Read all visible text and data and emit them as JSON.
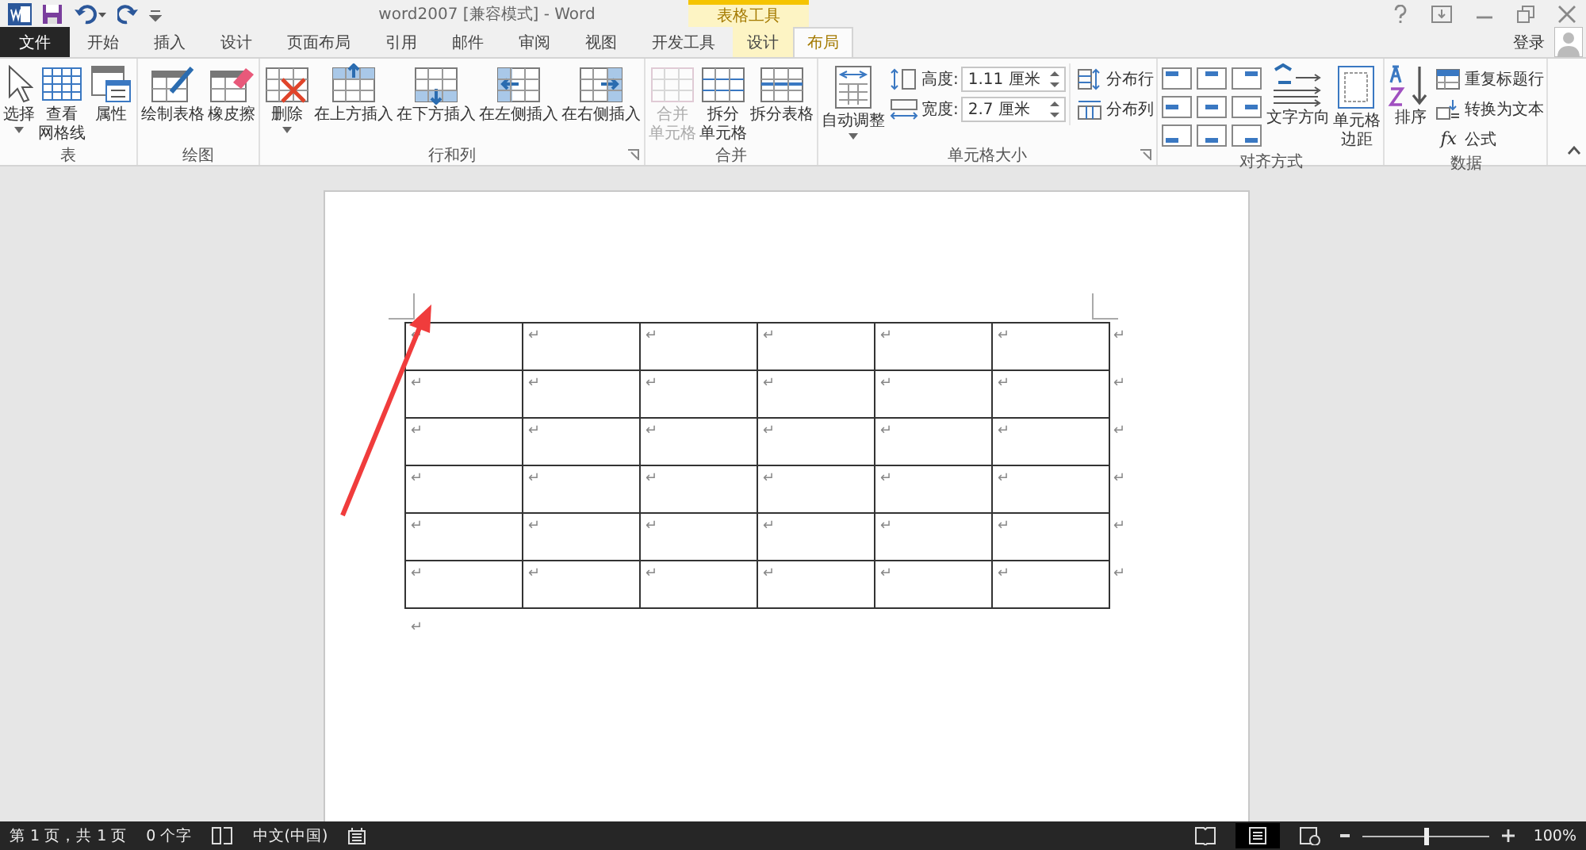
{
  "title_bar": {
    "title": "word2007 [兼容模式] - Word",
    "context_group": "表格工具",
    "login": "登录"
  },
  "tabs": [
    {
      "label": "文件",
      "kind": "file",
      "selected": false
    },
    {
      "label": "开始",
      "kind": "normal",
      "selected": false
    },
    {
      "label": "插入",
      "kind": "normal",
      "selected": false
    },
    {
      "label": "设计",
      "kind": "normal",
      "selected": false
    },
    {
      "label": "页面布局",
      "kind": "normal",
      "selected": false
    },
    {
      "label": "引用",
      "kind": "normal",
      "selected": false
    },
    {
      "label": "邮件",
      "kind": "normal",
      "selected": false
    },
    {
      "label": "审阅",
      "kind": "normal",
      "selected": false
    },
    {
      "label": "视图",
      "kind": "normal",
      "selected": false
    },
    {
      "label": "开发工具",
      "kind": "normal",
      "selected": false
    },
    {
      "label": "设计",
      "kind": "context",
      "selected": false
    },
    {
      "label": "布局",
      "kind": "context",
      "selected": true
    }
  ],
  "ribbon": [
    {
      "label": "表",
      "launcher": false,
      "items": [
        {
          "kind": "large",
          "lines": [
            "选择"
          ],
          "dropdown": true,
          "disabled": false
        },
        {
          "kind": "large",
          "lines": [
            "查看",
            "网格线"
          ],
          "dropdown": false,
          "disabled": false
        },
        {
          "kind": "large",
          "lines": [
            "属性"
          ],
          "dropdown": false,
          "disabled": false
        }
      ]
    },
    {
      "label": "绘图",
      "launcher": false,
      "items": [
        {
          "kind": "large",
          "lines": [
            "绘制表格"
          ],
          "dropdown": false,
          "disabled": false
        },
        {
          "kind": "large",
          "lines": [
            "橡皮擦"
          ],
          "dropdown": false,
          "disabled": false
        }
      ]
    },
    {
      "label": "行和列",
      "launcher": true,
      "items": [
        {
          "kind": "large",
          "lines": [
            "删除"
          ],
          "dropdown": true,
          "disabled": false
        },
        {
          "kind": "large",
          "lines": [
            "在上方插入"
          ],
          "dropdown": false,
          "disabled": false
        },
        {
          "kind": "large",
          "lines": [
            "在下方插入"
          ],
          "dropdown": false,
          "disabled": false
        },
        {
          "kind": "large",
          "lines": [
            "在左侧插入"
          ],
          "dropdown": false,
          "disabled": false
        },
        {
          "kind": "large",
          "lines": [
            "在右侧插入"
          ],
          "dropdown": false,
          "disabled": false
        }
      ]
    },
    {
      "label": "合并",
      "launcher": false,
      "items": [
        {
          "kind": "large",
          "lines": [
            "合并",
            "单元格"
          ],
          "dropdown": false,
          "disabled": true
        },
        {
          "kind": "large",
          "lines": [
            "拆分",
            "单元格"
          ],
          "dropdown": false,
          "disabled": false
        },
        {
          "kind": "large",
          "lines": [
            "拆分表格"
          ],
          "dropdown": false,
          "disabled": false
        }
      ]
    },
    {
      "label": "单元格大小",
      "launcher": true,
      "items": [
        {
          "kind": "large",
          "lines": [
            "自动调整"
          ],
          "dropdown": true,
          "disabled": false
        },
        {
          "kind": "fields",
          "fields": [
            {
              "label": "高度:",
              "value": "1.11 厘米"
            },
            {
              "label": "宽度:",
              "value": "2.7 厘米"
            }
          ]
        },
        {
          "kind": "small",
          "labels": [
            "分布行",
            "分布列"
          ]
        }
      ]
    },
    {
      "label": "对齐方式",
      "launcher": false,
      "items": [
        {
          "kind": "align"
        },
        {
          "kind": "large",
          "lines": [
            "文字方向"
          ],
          "dropdown": false,
          "disabled": false
        },
        {
          "kind": "large",
          "lines": [
            "单元格",
            "边距"
          ],
          "dropdown": false,
          "disabled": false
        }
      ]
    },
    {
      "label": "数据",
      "launcher": false,
      "items": [
        {
          "kind": "large",
          "lines": [
            "排序"
          ],
          "dropdown": false,
          "disabled": false
        },
        {
          "kind": "small",
          "labels": [
            "重复标题行",
            "转换为文本",
            "公式"
          ]
        }
      ]
    }
  ],
  "formula_glyph": "fx",
  "document": {
    "table": [
      [
        "↵",
        "↵",
        "↵",
        "↵",
        "↵",
        "↵"
      ],
      [
        "↵",
        "↵",
        "↵",
        "↵",
        "↵",
        "↵"
      ],
      [
        "↵",
        "↵",
        "↵",
        "↵",
        "↵",
        "↵"
      ],
      [
        "↵",
        "↵",
        "↵",
        "↵",
        "↵",
        "↵"
      ],
      [
        "↵",
        "↵",
        "↵",
        "↵",
        "↵",
        "↵"
      ],
      [
        "↵",
        "↵",
        "↵",
        "↵",
        "↵",
        "↵"
      ]
    ],
    "row_end_marks": [
      "↵",
      "↵",
      "↵",
      "↵",
      "↵",
      "↵"
    ],
    "paragraph_mark": "↵"
  },
  "status_bar": {
    "page": "第 1 页，共 1 页",
    "words": "0 个字",
    "language": "中文(中国)",
    "zoom": "100%",
    "zoom_slider": {
      "level": 0.5
    }
  }
}
